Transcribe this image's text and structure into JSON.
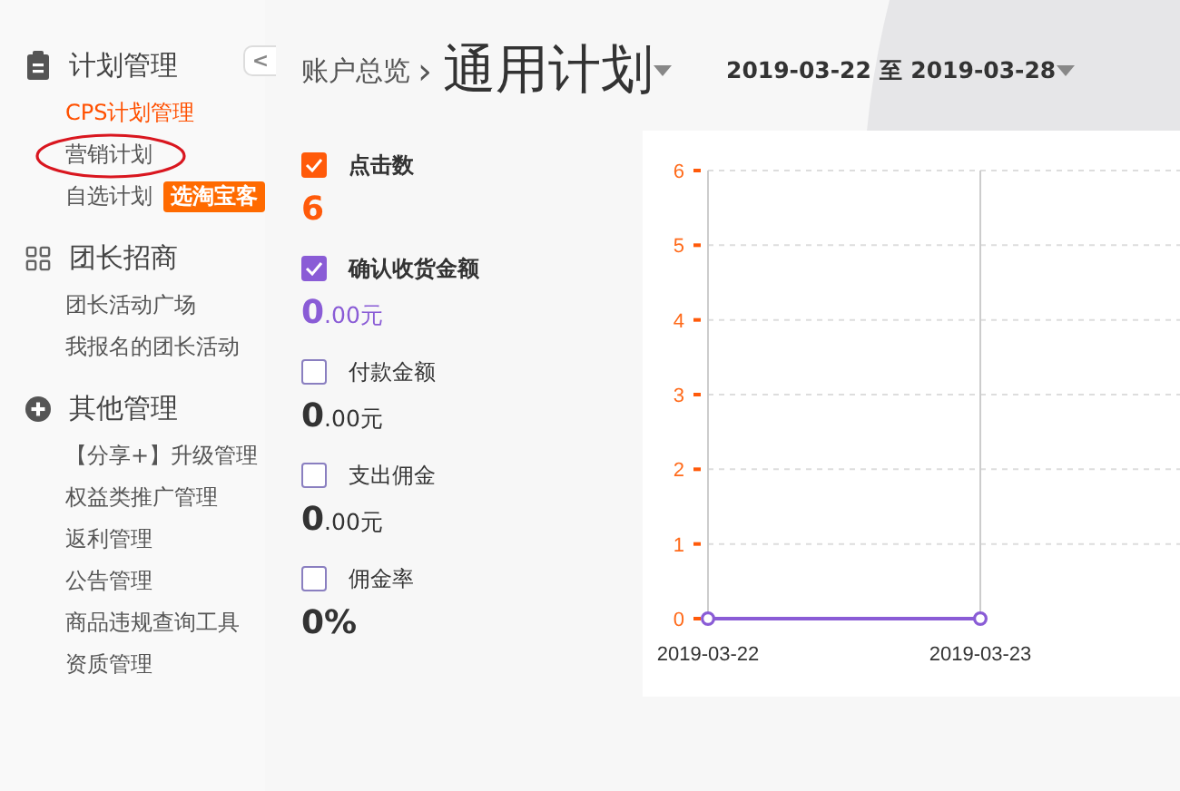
{
  "sidebar": {
    "collapse_button": "<",
    "groups": [
      {
        "title": "计划管理",
        "items": [
          {
            "label": "CPS计划管理",
            "selected": true,
            "circled": false
          },
          {
            "label": "营销计划",
            "selected": false,
            "circled": true
          },
          {
            "label": "自选计划",
            "selected": false,
            "circled": false,
            "badge": "选淘宝客"
          }
        ]
      },
      {
        "title": "团长招商",
        "items": [
          {
            "label": "团长活动广场",
            "selected": false,
            "circled": false
          },
          {
            "label": "我报名的团长活动",
            "selected": false,
            "circled": false
          }
        ]
      },
      {
        "title": "其他管理",
        "items": [
          {
            "label": "【分享+】升级管理",
            "selected": false,
            "circled": false
          },
          {
            "label": "权益类推广管理",
            "selected": false,
            "circled": false
          },
          {
            "label": "返利管理",
            "selected": false,
            "circled": false
          },
          {
            "label": "公告管理",
            "selected": false,
            "circled": false
          },
          {
            "label": "商品违规查询工具",
            "selected": false,
            "circled": false
          },
          {
            "label": "资质管理",
            "selected": false,
            "circled": false
          }
        ]
      }
    ]
  },
  "header": {
    "breadcrumb": "账户总览",
    "separator": "›",
    "title": "通用计划",
    "date_range": "2019-03-22 至 2019-03-28"
  },
  "metrics": [
    {
      "label": "点击数",
      "checked": true,
      "color": "#ff5a0a",
      "value": "6"
    },
    {
      "label": "确认收货金额",
      "checked": true,
      "color": "#8a5cd6",
      "value": "**0**.00元"
    },
    {
      "label": "付款金额",
      "checked": false,
      "color": "#8a7fc0",
      "value": "**0**.00元"
    },
    {
      "label": "支出佣金",
      "checked": false,
      "color": "#8a7fc0",
      "value": "**0**.00元"
    },
    {
      "label": "佣金率",
      "checked": false,
      "color": "#8a7fc0",
      "value": "0%"
    }
  ],
  "chart": {
    "chart_data": {
      "type": "line",
      "categories": [
        "2019-03-22",
        "2019-03-23"
      ],
      "series": [
        {
          "color": "#8a5cd6",
          "marker": "circle",
          "values": [
            0,
            0
          ]
        }
      ],
      "ylim": [
        0,
        6
      ],
      "yticks": [
        0,
        1,
        2,
        3,
        4,
        5,
        6
      ],
      "grid": true,
      "ref_lines": [
        {
          "axis": "x",
          "value": "2019-03-23",
          "color": "#cccccc"
        }
      ]
    }
  }
}
